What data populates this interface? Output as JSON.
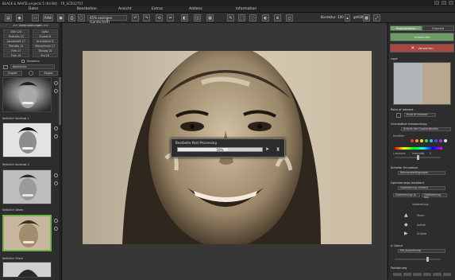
{
  "window": {
    "title": "BLACK & WHITE projects 5 (64 Bit) - 7R_SCD12757"
  },
  "menu": [
    "Datei",
    "Bearbeiten",
    "Ansicht",
    "Extras",
    "Addons",
    "Information"
  ],
  "toolbar": {
    "raw_label": "RAW",
    "zoom_value": "45% anzeigen (Landschaft)",
    "korrektur_label": "Korrektur: 100",
    "gridlines_label": "gefüllt"
  },
  "left_panel": {
    "header": ">> Voreinstellungen <<",
    "categories": [
      "Alle 120",
      "Optiz",
      "Portraits 15",
      "Sunset 6",
      "Landschaft 17",
      "Architektur 8",
      "Porträts 15",
      "Monochrom 17",
      "Film 17",
      "Tönung 10",
      "Film 19",
      "Pro 18"
    ],
    "filter_label": "Favoriten",
    "dropdown": "Natürliche",
    "import_label": "Import",
    "export_label": "Export",
    "presets": [
      "Natürlich Kontrast 1",
      "Natürlich Kontrast 2",
      "Natürlich Warm",
      "Natürlich Frisch"
    ]
  },
  "dialog": {
    "title": "Bearbeite Post-Processing",
    "progress_text": "59%",
    "progress": 0.59
  },
  "right_panel": {
    "tabs": [
      "Postkorrektur",
      "Experte"
    ],
    "apply_label": "Anwenden",
    "discard_label": "Verwerfen",
    "loupe_label": "Lupe",
    "poi_title": "Point of Interest",
    "poi_button": "Point of Interest",
    "color_section": "Grundsätze Umwandlung",
    "color_select": "Schnitt der Graufarbstufen",
    "color_label": "Farbfilter",
    "luminance_label": "Luminanz",
    "intensity_label": "Intensität",
    "intensity_value": "0",
    "film_section": "Schiefer Emulation",
    "film_select": "Rahmenbedingungen",
    "optimization_section": "Optimierungs-Assistent",
    "optimization_select": "Optimierung: einfach",
    "opt_left": "Optimierung: Ja",
    "opt_right": "Optimierung: aus",
    "steps": [
      "Vorbereitung",
      "Tönen",
      "Aufhell",
      "Schärfe"
    ],
    "tone_section": "A Colour",
    "tone_select": "Mit Ausrichtung",
    "grain_section": "Farbtönung"
  },
  "colors": {
    "accent_green": "#75a36d",
    "discard_red": "#b04a4a",
    "selection_green": "#6fb24a"
  }
}
